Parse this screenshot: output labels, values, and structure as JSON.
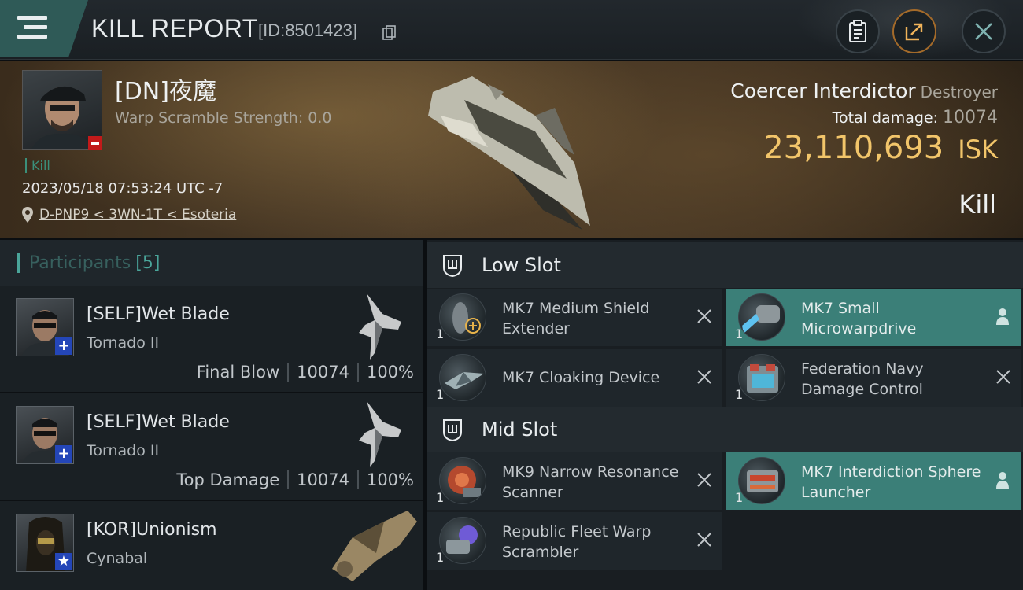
{
  "header": {
    "title": "KILL REPORT",
    "id_label": "[ID:8501423]"
  },
  "victim": {
    "name": "[DN]夜魔",
    "warp_scramble": "Warp Scramble Strength: 0.0",
    "tag": "Kill",
    "datetime": "2023/05/18 07:53:24 UTC -7",
    "location": "D-PNP9 < 3WN-1T < Esoteria",
    "ship": "Coercer Interdictor",
    "ship_class": "Destroyer",
    "total_damage_label": "Total damage:",
    "total_damage": "10074",
    "isk_value": "23,110,693",
    "isk_unit": "ISK",
    "result": "Kill"
  },
  "participants": {
    "label": "Participants",
    "count": "[5]",
    "rows": [
      {
        "name": "[SELF]Wet Blade",
        "ship": "Tornado II",
        "role": "Final Blow",
        "damage": "10074",
        "percent": "100%",
        "badge": "+"
      },
      {
        "name": "[SELF]Wet Blade",
        "ship": "Tornado II",
        "role": "Top Damage",
        "damage": "10074",
        "percent": "100%",
        "badge": "+"
      },
      {
        "name": "[KOR]Unionism",
        "ship": "Cynabal",
        "badge": "★"
      }
    ]
  },
  "low_slot": {
    "title": "Low Slot",
    "modules": [
      {
        "name": "MK7 Medium Shield Extender",
        "qty": "1"
      },
      {
        "name": "MK7 Small Microwarpdrive",
        "qty": "1"
      },
      {
        "name": "MK7 Cloaking Device",
        "qty": "1"
      },
      {
        "name": "Federation Navy Damage Control",
        "qty": "1"
      }
    ]
  },
  "mid_slot": {
    "title": "Mid Slot",
    "modules": [
      {
        "name": "MK9 Narrow Resonance Scanner",
        "qty": "1"
      },
      {
        "name": "MK7 Interdiction Sphere Launcher",
        "qty": "1"
      },
      {
        "name": "Republic Fleet Warp Scrambler",
        "qty": "1"
      }
    ]
  }
}
